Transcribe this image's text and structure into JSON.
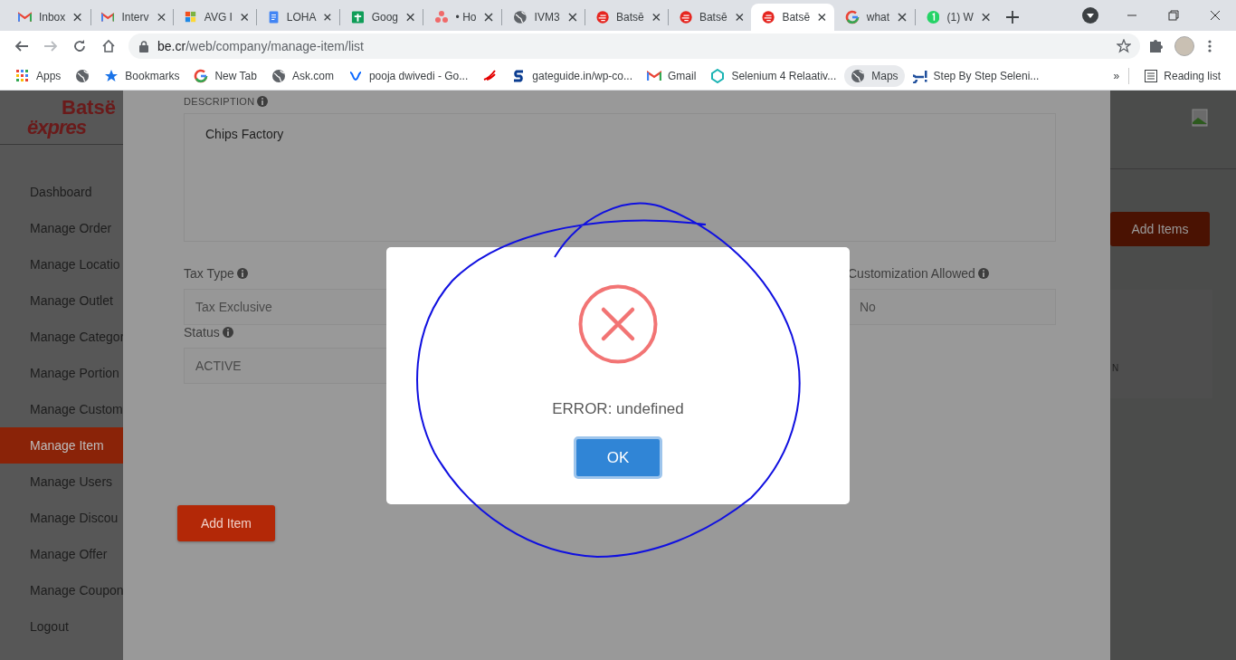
{
  "browser": {
    "tabs": [
      {
        "title": "Inbox",
        "selected": false
      },
      {
        "title": "Interv",
        "selected": false
      },
      {
        "title": "AVG I",
        "selected": false
      },
      {
        "title": "LOHA",
        "selected": false
      },
      {
        "title": "Goog",
        "selected": false
      },
      {
        "title": "• Ho",
        "selected": false
      },
      {
        "title": "IVM3",
        "selected": false
      },
      {
        "title": "Batsē",
        "selected": false
      },
      {
        "title": "Batsē",
        "selected": false
      },
      {
        "title": "Batsē",
        "selected": true
      },
      {
        "title": "what",
        "selected": false
      },
      {
        "title": "(1) W",
        "selected": false
      }
    ],
    "address_host": "be.cr",
    "address_path": "/web/company/manage-item/list",
    "bookmarks": [
      {
        "kind": "link",
        "label": "Apps"
      },
      {
        "kind": "icon"
      },
      {
        "kind": "link",
        "label": "Bookmarks"
      },
      {
        "kind": "link",
        "label": "New Tab"
      },
      {
        "kind": "link",
        "label": "Ask.com"
      },
      {
        "kind": "link",
        "label": "pooja dwivedi - Go..."
      },
      {
        "kind": "icon"
      },
      {
        "kind": "link",
        "label": "gateguide.in/wp-co..."
      },
      {
        "kind": "link",
        "label": "Gmail"
      },
      {
        "kind": "link",
        "label": "Selenium 4 Relaativ..."
      },
      {
        "kind": "chip",
        "label": "Maps"
      },
      {
        "kind": "link",
        "label": "Step By Step Seleni..."
      }
    ],
    "overflow": "»",
    "reading_list": "Reading list"
  },
  "app": {
    "logo": {
      "line1": "Batsë",
      "line2": "ëxpres"
    },
    "sidebar": [
      {
        "label": "Dashboard",
        "selected": false
      },
      {
        "label": "Manage Order",
        "selected": false
      },
      {
        "label": "Manage Locatio",
        "selected": false
      },
      {
        "label": "Manage Outlet",
        "selected": false
      },
      {
        "label": "Manage Categor",
        "selected": false
      },
      {
        "label": "Manage Portion",
        "selected": false
      },
      {
        "label": "Manage Custom",
        "selected": false
      },
      {
        "label": "Manage Item",
        "selected": true
      },
      {
        "label": "Manage Users",
        "selected": false
      },
      {
        "label": "Manage Discou",
        "selected": false
      },
      {
        "label": "Manage Offer",
        "selected": false
      },
      {
        "label": "Manage Coupon",
        "selected": false
      },
      {
        "label": "Logout",
        "selected": false
      }
    ],
    "add_items_button": "Add Items",
    "table_header": "N"
  },
  "panel": {
    "description": {
      "label": "DESCRIPTION",
      "value": "Chips Factory"
    },
    "fields": [
      {
        "label": "Tax Type",
        "value": "Tax Exclusive"
      },
      {
        "label": "Customization Allowed",
        "value": "No"
      },
      {
        "label": "Status",
        "value": "ACTIVE"
      }
    ],
    "add_item_button": "Add Item"
  },
  "dialog": {
    "message": "ERROR: undefined",
    "ok_button": "OK"
  }
}
